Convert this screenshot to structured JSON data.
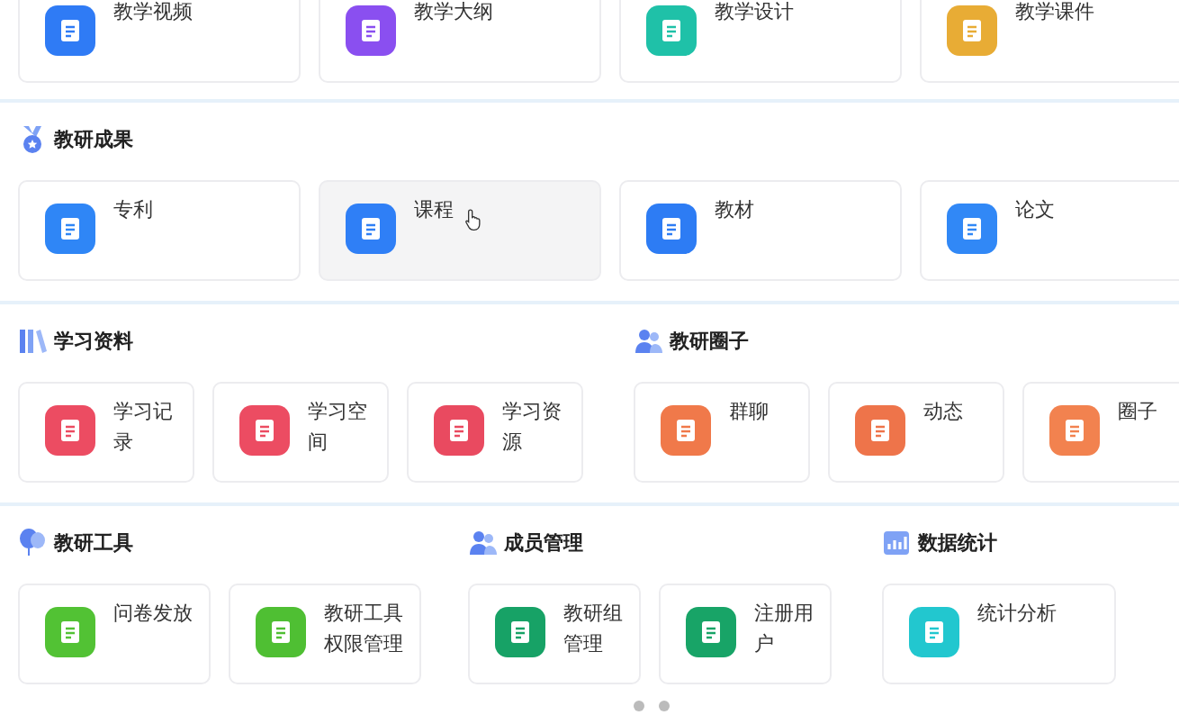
{
  "sections": [
    {
      "kind": "plain",
      "groups": [
        {
          "items": [
            {
              "label": "教学视频",
              "color": "#2f7bf5",
              "hovered": false
            },
            {
              "label": "教学大纲",
              "color": "#8a4ff0",
              "hovered": false
            },
            {
              "label": "教学设计",
              "color": "#1fc1a8",
              "hovered": false
            },
            {
              "label": "教学课件",
              "color": "#e8ac35",
              "hovered": false
            }
          ]
        }
      ]
    },
    {
      "kind": "titled",
      "groups": [
        {
          "title": "教研成果",
          "items": [
            {
              "label": "专利",
              "color": "#2f86f6",
              "hovered": false
            },
            {
              "label": "课程",
              "color": "#2f7ff6",
              "hovered": true
            },
            {
              "label": "教材",
              "color": "#2d7cf4",
              "hovered": false
            },
            {
              "label": "论文",
              "color": "#3188f6",
              "hovered": false
            }
          ]
        }
      ]
    },
    {
      "kind": "titled",
      "groups": [
        {
          "title": "学习资料",
          "items": [
            {
              "label": "学习记录",
              "color": "#ec4c62",
              "hovered": false
            },
            {
              "label": "学习空间",
              "color": "#ec4c62",
              "hovered": false
            },
            {
              "label": "学习资源",
              "color": "#e94a60",
              "hovered": false
            }
          ]
        },
        {
          "title": "教研圈子",
          "items": [
            {
              "label": "群聊",
              "color": "#f0794a",
              "hovered": false
            },
            {
              "label": "动态",
              "color": "#ee744a",
              "hovered": false
            },
            {
              "label": "圈子",
              "color": "#f2824f",
              "hovered": false
            }
          ]
        }
      ]
    },
    {
      "kind": "titled",
      "groups": [
        {
          "title": "教研工具",
          "items": [
            {
              "label": "问卷发放",
              "color": "#52c234",
              "hovered": false
            },
            {
              "label": "教研工具权限管理",
              "color": "#4fbf33",
              "hovered": false
            }
          ]
        },
        {
          "title": "成员管理",
          "items": [
            {
              "label": "教研组管理",
              "color": "#17a266",
              "hovered": false
            },
            {
              "label": "注册用户",
              "color": "#18a467",
              "hovered": false
            }
          ]
        },
        {
          "title": "数据统计",
          "items": [
            {
              "label": "统计分析",
              "color": "#22c7cf",
              "hovered": false
            }
          ]
        }
      ]
    }
  ]
}
